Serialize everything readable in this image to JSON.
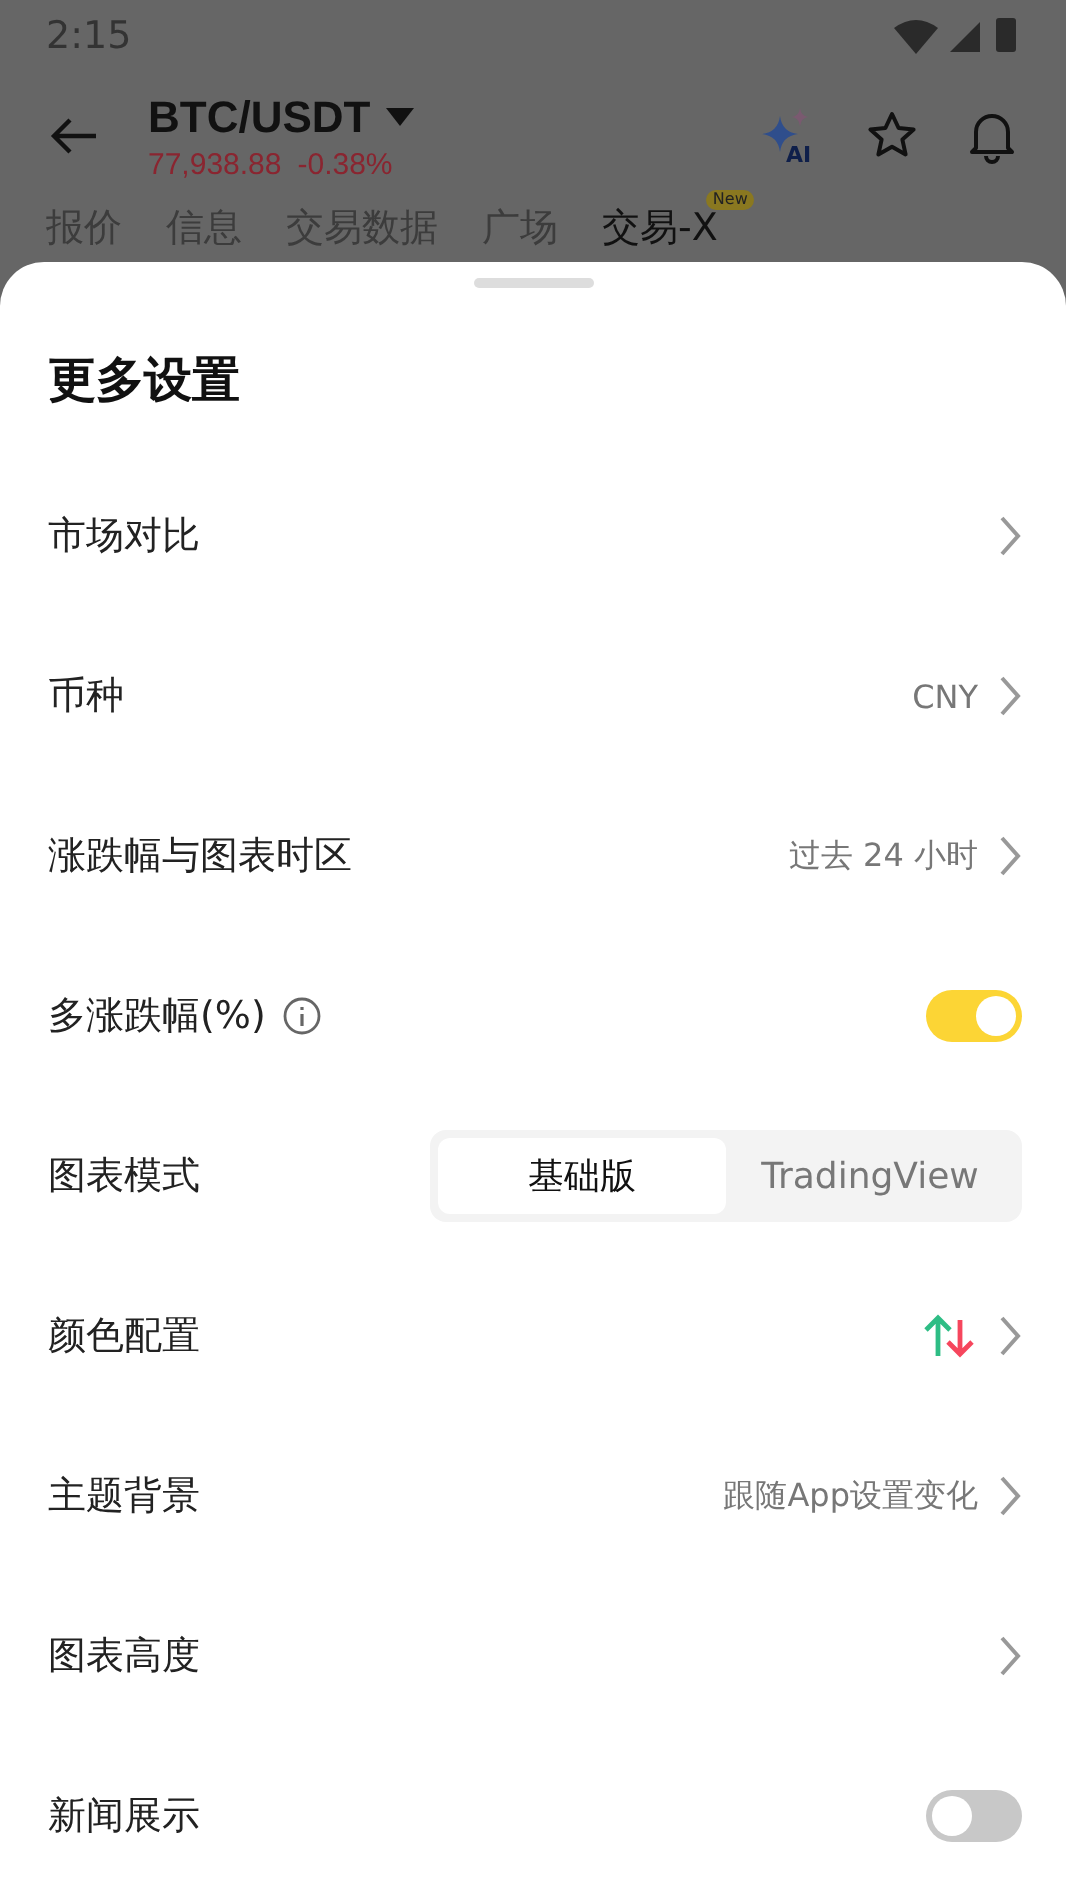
{
  "status_bar": {
    "time": "2:15"
  },
  "header": {
    "pair": "BTC/USDT",
    "price": "77,938.88",
    "change": "-0.38%",
    "ai_label": "AI"
  },
  "tabs": [
    {
      "label": "报价",
      "selected": false
    },
    {
      "label": "信息",
      "selected": false
    },
    {
      "label": "交易数据",
      "selected": false
    },
    {
      "label": "广场",
      "selected": false
    },
    {
      "label": "交易-X",
      "selected": true,
      "badge": "New"
    }
  ],
  "sheet": {
    "title": "更多设置",
    "rows": [
      {
        "kind": "link",
        "label": "市场对比"
      },
      {
        "kind": "link",
        "label": "币种",
        "value": "CNY"
      },
      {
        "kind": "link",
        "label": "涨跌幅与图表时区",
        "value": "过去 24 小时"
      },
      {
        "kind": "toggle",
        "label": "多涨跌幅(%)",
        "info": true,
        "on": true
      },
      {
        "kind": "segmented",
        "label": "图表模式",
        "options": [
          {
            "label": "基础版",
            "selected": true
          },
          {
            "label": "TradingView",
            "selected": false
          }
        ]
      },
      {
        "kind": "link",
        "label": "颜色配置",
        "colors": true
      },
      {
        "kind": "link",
        "label": "主题背景",
        "value": "跟随App设置变化"
      },
      {
        "kind": "link",
        "label": "图表高度"
      },
      {
        "kind": "toggle",
        "label": "新闻展示",
        "on": false
      }
    ]
  }
}
